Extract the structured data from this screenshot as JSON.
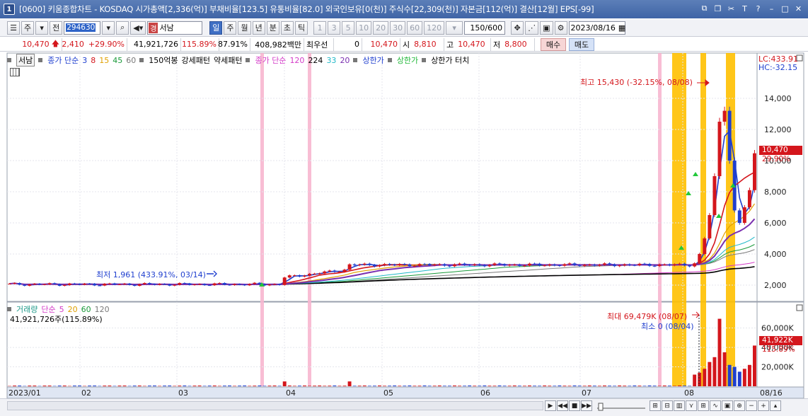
{
  "window": {
    "number": "1",
    "title": "[0600] 키움종합차트 - KOSDAQ 시가총액[2,336(억)] 부채비율[123.5] 유통비율[82.0] 외국인보유[0(천)] 주식수[22,309(천)] 자본금[112(억)] 결산[12월] EPS[-99]"
  },
  "toolbar": {
    "kind_label": "주",
    "prev_label": "전",
    "stock_code": "294630",
    "stock_badge": "경",
    "stock_name": "서남",
    "periods": [
      "일",
      "주",
      "월",
      "년",
      "분",
      "초",
      "틱"
    ],
    "selected_period": "일",
    "intervals": [
      "1",
      "3",
      "5",
      "10",
      "20",
      "30",
      "60",
      "120"
    ],
    "count": "150/600",
    "date": "2023/08/16"
  },
  "price_bar": {
    "price": "10,470",
    "change": "2,410",
    "change_rate": "+29.90%",
    "volume": "41,921,726",
    "volume_rate": "115.89%",
    "turnover": "87.91%",
    "amount": "408,982백만",
    "best_label": "최우선",
    "best_value": "0",
    "current": "10,470",
    "open_label": "시",
    "open": "8,810",
    "high_label": "고",
    "high": "10,470",
    "low_label": "저",
    "low": "8,800",
    "buy_label": "매수",
    "sell_label": "매도"
  },
  "price_legend": {
    "stock_tag": "서남",
    "ma_label": "종가 단순",
    "ma_periods": [
      "3",
      "8",
      "15",
      "45",
      "60"
    ],
    "ma_colors": [
      "#1f3fcf",
      "#d4161c",
      "#e0a000",
      "#1a9a3a",
      "#7a7a7a"
    ],
    "pattern1": "150억봉",
    "pattern2": "강세패턴",
    "pattern3": "약세패턴",
    "ma2_label": "종가 단순",
    "ma2_periods": [
      "120",
      "224",
      "33",
      "20"
    ],
    "ma2_colors": [
      "#d43cc8",
      "#000000",
      "#1fb8c8",
      "#7a2fb0"
    ],
    "limit1": "상한가",
    "limit2": "상한가",
    "limit3": "상한가 터치"
  },
  "volume_legend": {
    "label": "거래량",
    "ma_label": "단순",
    "periods": [
      "5",
      "20",
      "60",
      "120"
    ],
    "period_colors": [
      "#d43cc8",
      "#e0a000",
      "#1a9a3a",
      "#7a7a7a"
    ],
    "value": "41,921,726주(115.89%)"
  },
  "right_info": {
    "lc": "LC:433.91",
    "hc": "HC:-32.15",
    "price_tag": "10,470",
    "price_rate": "29.90%",
    "vol_tag": "41,922K",
    "vol_rate": "115.89%"
  },
  "annotations": {
    "high": "최고 15,430 (-32.15%, 08/08)",
    "low": "최저 1,961 (433.91%, 03/14)",
    "vol_max": "최대 69,479K (08/07)",
    "vol_min": "최소 0 (08/04)"
  },
  "chart_data": {
    "type": "candlestick",
    "x_axis": [
      "2023/01",
      "02",
      "03",
      "04",
      "05",
      "06",
      "07",
      "08",
      "08/16"
    ],
    "price_axis": {
      "ticks": [
        2000,
        4000,
        6000,
        8000,
        10000,
        12000,
        14000
      ],
      "tick_labels": [
        "2,000",
        "4,000",
        "6,000",
        "8,000",
        "10,000",
        "12,000",
        "14,000"
      ],
      "range": [
        1000,
        16000
      ]
    },
    "volume_axis": {
      "ticks": [
        20000,
        40000,
        60000
      ],
      "tick_labels": [
        "20,000K",
        "40,000K",
        "60,000K"
      ],
      "range": [
        0,
        75000
      ]
    },
    "price_phases": [
      {
        "from": "2023/01",
        "to": "03/14",
        "level": 2050
      },
      {
        "from": "03/15",
        "to": "04/05",
        "level": 2500
      },
      {
        "from": "04/06",
        "to": "07/31",
        "level": 3300
      }
    ],
    "recent_closes": [
      3400,
      4000,
      5000,
      6500,
      9000,
      12500,
      13200,
      10000,
      6800,
      6000,
      7000,
      8100,
      10470
    ],
    "recent_volume_k": [
      12000,
      14000,
      18000,
      25000,
      30000,
      69479,
      35000,
      22000,
      20000,
      15000,
      18000,
      22000,
      41922
    ],
    "last": {
      "close": 10470,
      "high": 15430,
      "low": 1961
    }
  }
}
